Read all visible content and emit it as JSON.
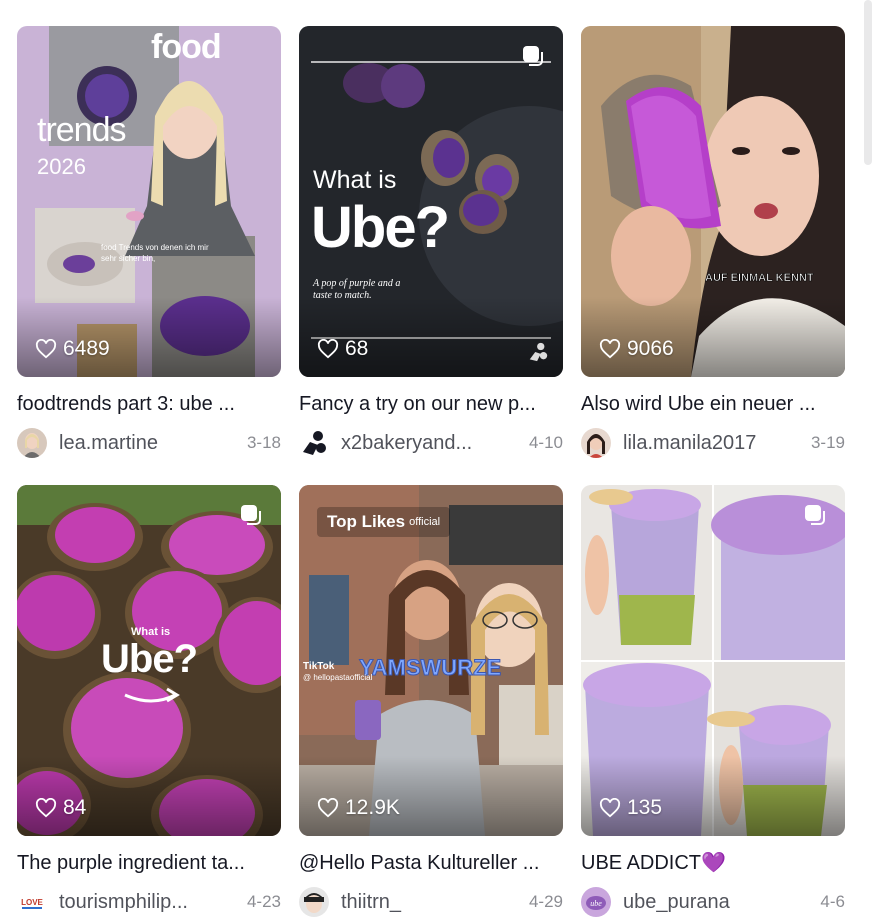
{
  "cards": [
    {
      "likes": "6489",
      "title": "foodtrends part 3: ube ...",
      "user": "lea.martine",
      "date": "3-18",
      "overlay": {
        "line1": "food",
        "line2": "trends",
        "line3": "2026",
        "caption": "food Trends von denen ich mir sehr sicher bin,"
      }
    },
    {
      "likes": "68",
      "title": "Fancy a try on our new p...",
      "user": "x2bakeryand...",
      "date": "4-10",
      "overlay": {
        "line1": "What is",
        "line2": "Ube?",
        "caption1": "A pop of purple and a",
        "caption2": "taste to match."
      }
    },
    {
      "likes": "9066",
      "title": "Also wird Ube ein neuer ...",
      "user": "lila.manila2017",
      "date": "3-19",
      "overlay": {
        "caption": "AUF EINMAL KENNT"
      }
    },
    {
      "likes": "84",
      "title": "The purple ingredient ta...",
      "user": "tourismphilip...",
      "date": "4-23",
      "overlay": {
        "line1": "What is",
        "line2": "Ube?"
      }
    },
    {
      "likes": "12.9K",
      "title": "@Hello Pasta Kultureller ...",
      "user": "thiitrn_",
      "date": "4-29",
      "overlay": {
        "badge": "Top Likes",
        "handle": "official",
        "caption": "YAMSWURZE",
        "tiktok": "TikTok",
        "tiktok_handle": "@ hellopastaofficial"
      }
    },
    {
      "likes": "135",
      "title": "UBE ADDICT💜",
      "user": "ube_purana",
      "date": "4-6",
      "overlay": {}
    }
  ],
  "colors": {
    "text_primary": "#161823",
    "ube_purple": "#9b4fd0",
    "like_text": "#ffffff"
  },
  "icons": {
    "likes": "heart-outline-icon",
    "multi": "photo-carousel-icon"
  }
}
